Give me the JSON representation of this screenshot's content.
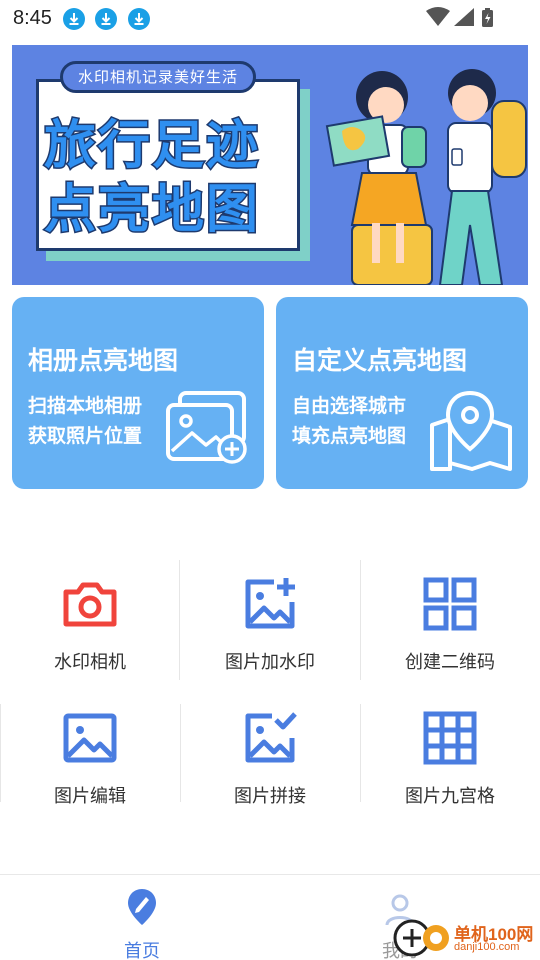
{
  "status_bar": {
    "time": "8:45",
    "notification_icons": [
      "download-icon",
      "download-icon",
      "download-icon"
    ],
    "system_icons": [
      "wifi-icon",
      "signal-icon",
      "battery-charging-icon"
    ]
  },
  "banner": {
    "pill_text": "水印相机记录美好生活",
    "title_line1": "旅行足迹",
    "title_line2": "点亮地图",
    "background_color": "#5d83e2"
  },
  "features": [
    {
      "title": "相册点亮地图",
      "desc_line1": "扫描本地相册",
      "desc_line2": "获取照片位置",
      "icon": "photo-add-icon"
    },
    {
      "title": "自定义点亮地图",
      "desc_line1": "自由选择城市",
      "desc_line2": "填充点亮地图",
      "icon": "map-pin-icon"
    }
  ],
  "feature_color": "#66b1f3",
  "tools": [
    {
      "label": "水印相机",
      "icon": "camera-icon",
      "color": "#f0443c"
    },
    {
      "label": "图片加水印",
      "icon": "image-add-icon",
      "color": "#4a7de0"
    },
    {
      "label": "创建二维码",
      "icon": "qr-grid-icon",
      "color": "#4a7de0"
    },
    {
      "label": "图片编辑",
      "icon": "image-icon",
      "color": "#4a7de0"
    },
    {
      "label": "图片拼接",
      "icon": "image-check-icon",
      "color": "#4a7de0"
    },
    {
      "label": "图片九宫格",
      "icon": "grid-nine-icon",
      "color": "#4a7de0"
    }
  ],
  "bottom_nav": {
    "home_label": "首页",
    "mine_label": "我的",
    "active_color": "#4a7de0"
  },
  "watermark": {
    "brand": "单机100网",
    "url": "danji100.com"
  }
}
